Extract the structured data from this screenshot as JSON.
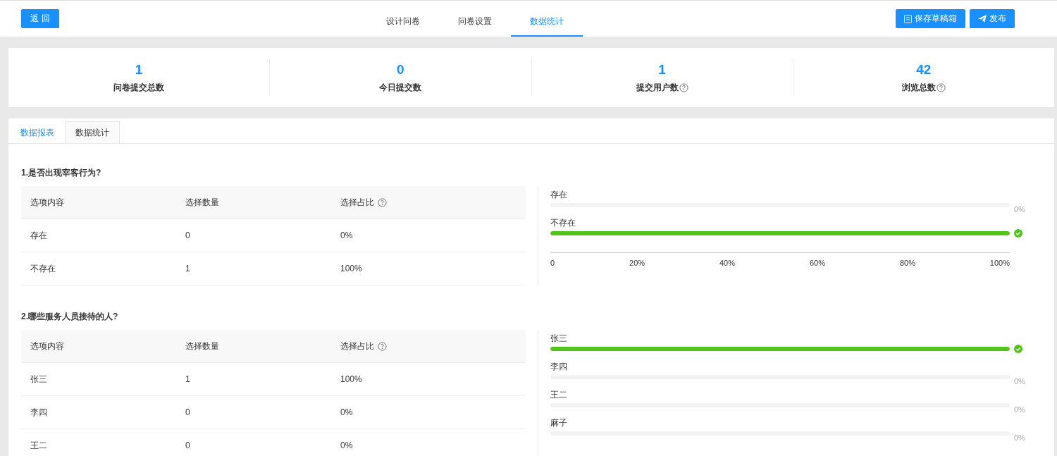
{
  "header": {
    "back_button": "返 回",
    "tabs": [
      {
        "label": "设计问卷",
        "selected": false
      },
      {
        "label": "问卷设置",
        "selected": false
      },
      {
        "label": "数据统计",
        "selected": true
      }
    ],
    "save_button": "保存草稿箱",
    "publish_button": "发布"
  },
  "stats": [
    {
      "value": "1",
      "label": "问卷提交总数",
      "help": false
    },
    {
      "value": "0",
      "label": "今日提交数",
      "help": false
    },
    {
      "value": "1",
      "label": "提交用户数",
      "help": true
    },
    {
      "value": "42",
      "label": "浏览总数",
      "help": true
    }
  ],
  "report_tabs": [
    {
      "label": "数据报表",
      "selected": true
    },
    {
      "label": "数据统计",
      "selected": false
    }
  ],
  "questions": [
    {
      "title": "1.是否出现宰客行为?",
      "columns": [
        "选项内容",
        "选择数量",
        "选择占比"
      ],
      "rows": [
        [
          "存在",
          "0",
          "0%"
        ],
        [
          "不存在",
          "1",
          "100%"
        ]
      ],
      "bars": [
        {
          "label": "存在",
          "level": 0,
          "percent": "0%"
        },
        {
          "label": "不存在",
          "level": 1
        }
      ],
      "axis_ticks": [
        "0",
        "20%",
        "40%",
        "60%",
        "80%",
        "100%"
      ]
    },
    {
      "title": "2.哪些服务人员接待的人?",
      "columns": [
        "选项内容",
        "选择数量",
        "选择占比"
      ],
      "rows": [
        [
          "张三",
          "1",
          "100%"
        ],
        [
          "李四",
          "0",
          "0%"
        ],
        [
          "王二",
          "0",
          "0%"
        ]
      ],
      "bars": [
        {
          "label": "张三",
          "level": 1
        },
        {
          "label": "李四",
          "level": 0,
          "percent": "0%"
        },
        {
          "label": "王二",
          "level": 0,
          "percent": "0%"
        },
        {
          "label": "麻子",
          "level": 0,
          "percent": "0%"
        }
      ]
    }
  ]
}
